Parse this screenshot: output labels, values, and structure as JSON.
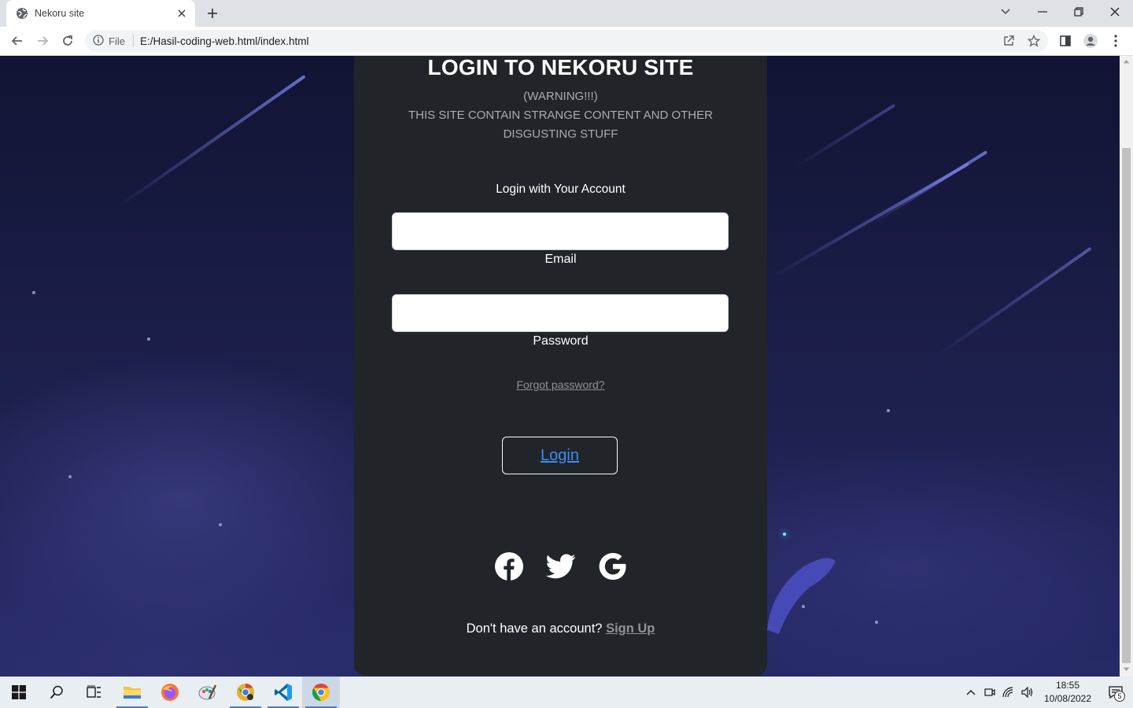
{
  "browser": {
    "tab_title": "Nekoru site",
    "url_scheme_label": "File",
    "url": "E:/Hasil-coding-web.html/index.html"
  },
  "page": {
    "title": "LOGIN TO NEKORU SITE",
    "warning_line1": "(WARNING!!!)",
    "warning_line2": "THIS SITE CONTAIN STRANGE CONTENT AND OTHER DISGUSTING STUFF",
    "login_with": "Login with Your Account",
    "email_label": "Email",
    "email_value": "",
    "password_label": "Password",
    "password_value": "",
    "forgot_password": "Forgot password?",
    "login_button": "Login",
    "signup_prompt": "Don't have an account?",
    "signup_link": "Sign Up",
    "social_icons": [
      "facebook-icon",
      "twitter-icon",
      "google-icon"
    ]
  },
  "taskbar": {
    "apps": [
      "start-icon",
      "search-icon",
      "task-view-icon",
      "file-explorer-icon",
      "firefox-icon",
      "paint-icon",
      "chrome-canary-icon",
      "vscode-icon",
      "chrome-icon"
    ],
    "time": "18:55",
    "date": "10/08/2022",
    "notification_count": "5"
  },
  "colors": {
    "card_bg": "#212529",
    "link_blue": "#3d8bfd",
    "muted_text": "#a9acb0",
    "sky_dark": "#111433"
  }
}
